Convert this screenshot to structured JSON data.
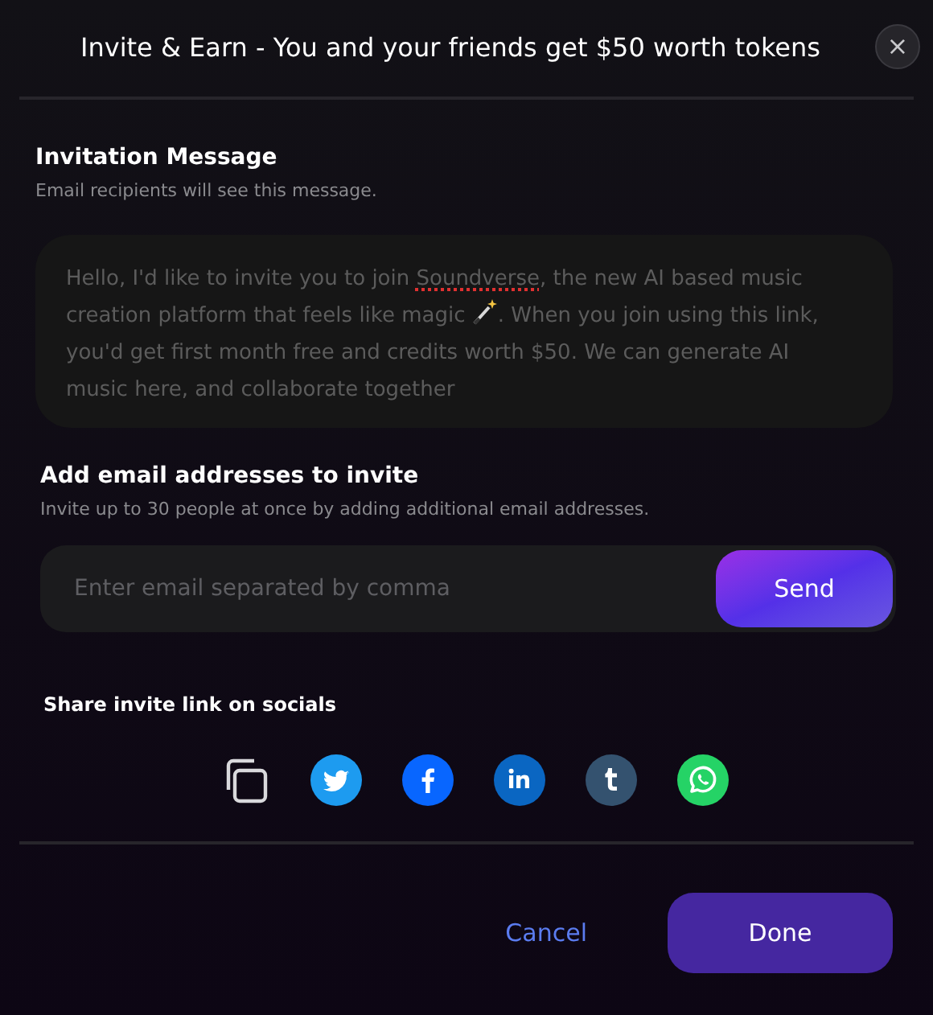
{
  "dialog": {
    "title": "Invite & Earn - You and your friends get $50 worth tokens",
    "close": "×"
  },
  "invitation": {
    "heading": "Invitation Message",
    "subtitle": "Email recipients will see this message.",
    "message": [
      {
        "kind": "text",
        "text": "Hello, I'd like to invite you to join ",
        "flagged": false
      },
      {
        "kind": "text",
        "text": "Soundverse",
        "flagged": true
      },
      {
        "kind": "text",
        "text": ", the new AI based music creation platform that feels like magic ",
        "flagged": false
      },
      {
        "kind": "wand"
      },
      {
        "kind": "text",
        "text": ". When you join using this link, you'd get first month free and credits worth $50. We can generate AI music here, and collaborate together",
        "flagged": false
      }
    ]
  },
  "email": {
    "heading": "Add email addresses to invite",
    "subtitle": "Invite up to 30 people at once by adding additional email addresses.",
    "placeholder": "Enter email separated by comma",
    "send": "Send"
  },
  "share": {
    "heading": "Share invite link on socials",
    "buttons": [
      {
        "kind": "copy"
      },
      {
        "kind": "twitter"
      },
      {
        "kind": "facebook"
      },
      {
        "kind": "linkedin"
      },
      {
        "kind": "tumblr"
      },
      {
        "kind": "whatsapp"
      }
    ]
  },
  "footer": {
    "cancel": "Cancel",
    "done": "Done"
  }
}
